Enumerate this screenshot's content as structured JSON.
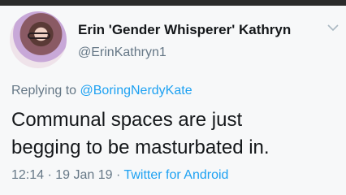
{
  "author": {
    "display_name": "Erin 'Gender Whisperer' Kathryn",
    "handle": "@ErinKathryn1"
  },
  "reply": {
    "prefix": "Replying to",
    "mention": "@BoringNerdyKate"
  },
  "tweet": {
    "line1": "Communal spaces are just",
    "line2": "begging to be masturbated in."
  },
  "meta": {
    "time": "12:14",
    "sep1": " · ",
    "date": "19 Jan 19",
    "sep2": " · ",
    "source": "Twitter for Android"
  },
  "colors": {
    "link": "#1da1f2",
    "muted": "#657786",
    "text": "#14171a"
  },
  "icons": {
    "menu": "chevron-down-icon"
  }
}
